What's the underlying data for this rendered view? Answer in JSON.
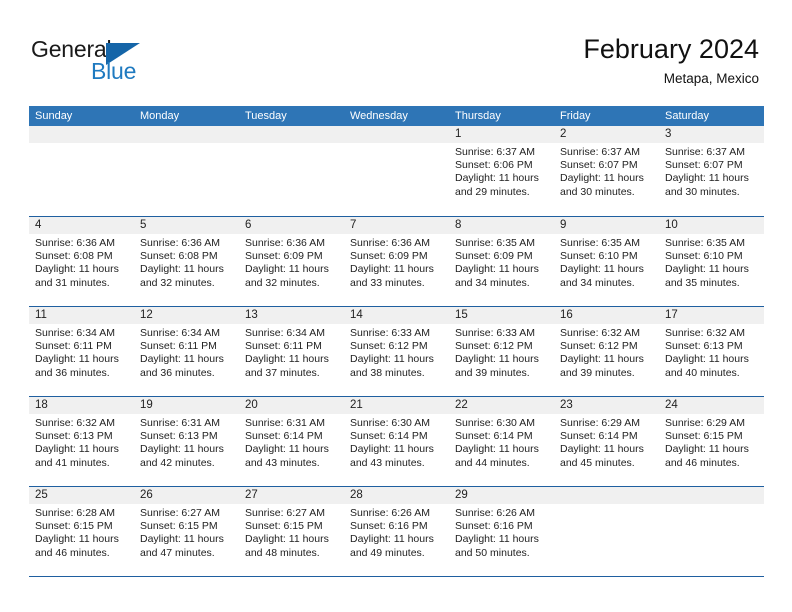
{
  "logo": {
    "word_top": "General",
    "word_bottom": "Blue",
    "triangle_color": "#1565a8",
    "blue_text_color": "#1f7ac0"
  },
  "header": {
    "title": "February 2024",
    "subtitle": "Metapa, Mexico",
    "weekday_header_bg": "#2e75b6",
    "row_separator_color": "#1f5fa0",
    "date_band_bg": "#f0f0f0"
  },
  "weekdays": [
    "Sunday",
    "Monday",
    "Tuesday",
    "Wednesday",
    "Thursday",
    "Friday",
    "Saturday"
  ],
  "weeks": [
    [
      {
        "day": "",
        "lines": []
      },
      {
        "day": "",
        "lines": []
      },
      {
        "day": "",
        "lines": []
      },
      {
        "day": "",
        "lines": []
      },
      {
        "day": "1",
        "lines": [
          "Sunrise: 6:37 AM",
          "Sunset: 6:06 PM",
          "Daylight: 11 hours",
          "and 29 minutes."
        ]
      },
      {
        "day": "2",
        "lines": [
          "Sunrise: 6:37 AM",
          "Sunset: 6:07 PM",
          "Daylight: 11 hours",
          "and 30 minutes."
        ]
      },
      {
        "day": "3",
        "lines": [
          "Sunrise: 6:37 AM",
          "Sunset: 6:07 PM",
          "Daylight: 11 hours",
          "and 30 minutes."
        ]
      }
    ],
    [
      {
        "day": "4",
        "lines": [
          "Sunrise: 6:36 AM",
          "Sunset: 6:08 PM",
          "Daylight: 11 hours",
          "and 31 minutes."
        ]
      },
      {
        "day": "5",
        "lines": [
          "Sunrise: 6:36 AM",
          "Sunset: 6:08 PM",
          "Daylight: 11 hours",
          "and 32 minutes."
        ]
      },
      {
        "day": "6",
        "lines": [
          "Sunrise: 6:36 AM",
          "Sunset: 6:09 PM",
          "Daylight: 11 hours",
          "and 32 minutes."
        ]
      },
      {
        "day": "7",
        "lines": [
          "Sunrise: 6:36 AM",
          "Sunset: 6:09 PM",
          "Daylight: 11 hours",
          "and 33 minutes."
        ]
      },
      {
        "day": "8",
        "lines": [
          "Sunrise: 6:35 AM",
          "Sunset: 6:09 PM",
          "Daylight: 11 hours",
          "and 34 minutes."
        ]
      },
      {
        "day": "9",
        "lines": [
          "Sunrise: 6:35 AM",
          "Sunset: 6:10 PM",
          "Daylight: 11 hours",
          "and 34 minutes."
        ]
      },
      {
        "day": "10",
        "lines": [
          "Sunrise: 6:35 AM",
          "Sunset: 6:10 PM",
          "Daylight: 11 hours",
          "and 35 minutes."
        ]
      }
    ],
    [
      {
        "day": "11",
        "lines": [
          "Sunrise: 6:34 AM",
          "Sunset: 6:11 PM",
          "Daylight: 11 hours",
          "and 36 minutes."
        ]
      },
      {
        "day": "12",
        "lines": [
          "Sunrise: 6:34 AM",
          "Sunset: 6:11 PM",
          "Daylight: 11 hours",
          "and 36 minutes."
        ]
      },
      {
        "day": "13",
        "lines": [
          "Sunrise: 6:34 AM",
          "Sunset: 6:11 PM",
          "Daylight: 11 hours",
          "and 37 minutes."
        ]
      },
      {
        "day": "14",
        "lines": [
          "Sunrise: 6:33 AM",
          "Sunset: 6:12 PM",
          "Daylight: 11 hours",
          "and 38 minutes."
        ]
      },
      {
        "day": "15",
        "lines": [
          "Sunrise: 6:33 AM",
          "Sunset: 6:12 PM",
          "Daylight: 11 hours",
          "and 39 minutes."
        ]
      },
      {
        "day": "16",
        "lines": [
          "Sunrise: 6:32 AM",
          "Sunset: 6:12 PM",
          "Daylight: 11 hours",
          "and 39 minutes."
        ]
      },
      {
        "day": "17",
        "lines": [
          "Sunrise: 6:32 AM",
          "Sunset: 6:13 PM",
          "Daylight: 11 hours",
          "and 40 minutes."
        ]
      }
    ],
    [
      {
        "day": "18",
        "lines": [
          "Sunrise: 6:32 AM",
          "Sunset: 6:13 PM",
          "Daylight: 11 hours",
          "and 41 minutes."
        ]
      },
      {
        "day": "19",
        "lines": [
          "Sunrise: 6:31 AM",
          "Sunset: 6:13 PM",
          "Daylight: 11 hours",
          "and 42 minutes."
        ]
      },
      {
        "day": "20",
        "lines": [
          "Sunrise: 6:31 AM",
          "Sunset: 6:14 PM",
          "Daylight: 11 hours",
          "and 43 minutes."
        ]
      },
      {
        "day": "21",
        "lines": [
          "Sunrise: 6:30 AM",
          "Sunset: 6:14 PM",
          "Daylight: 11 hours",
          "and 43 minutes."
        ]
      },
      {
        "day": "22",
        "lines": [
          "Sunrise: 6:30 AM",
          "Sunset: 6:14 PM",
          "Daylight: 11 hours",
          "and 44 minutes."
        ]
      },
      {
        "day": "23",
        "lines": [
          "Sunrise: 6:29 AM",
          "Sunset: 6:14 PM",
          "Daylight: 11 hours",
          "and 45 minutes."
        ]
      },
      {
        "day": "24",
        "lines": [
          "Sunrise: 6:29 AM",
          "Sunset: 6:15 PM",
          "Daylight: 11 hours",
          "and 46 minutes."
        ]
      }
    ],
    [
      {
        "day": "25",
        "lines": [
          "Sunrise: 6:28 AM",
          "Sunset: 6:15 PM",
          "Daylight: 11 hours",
          "and 46 minutes."
        ]
      },
      {
        "day": "26",
        "lines": [
          "Sunrise: 6:27 AM",
          "Sunset: 6:15 PM",
          "Daylight: 11 hours",
          "and 47 minutes."
        ]
      },
      {
        "day": "27",
        "lines": [
          "Sunrise: 6:27 AM",
          "Sunset: 6:15 PM",
          "Daylight: 11 hours",
          "and 48 minutes."
        ]
      },
      {
        "day": "28",
        "lines": [
          "Sunrise: 6:26 AM",
          "Sunset: 6:16 PM",
          "Daylight: 11 hours",
          "and 49 minutes."
        ]
      },
      {
        "day": "29",
        "lines": [
          "Sunrise: 6:26 AM",
          "Sunset: 6:16 PM",
          "Daylight: 11 hours",
          "and 50 minutes."
        ]
      },
      {
        "day": "",
        "lines": []
      },
      {
        "day": "",
        "lines": []
      }
    ]
  ]
}
